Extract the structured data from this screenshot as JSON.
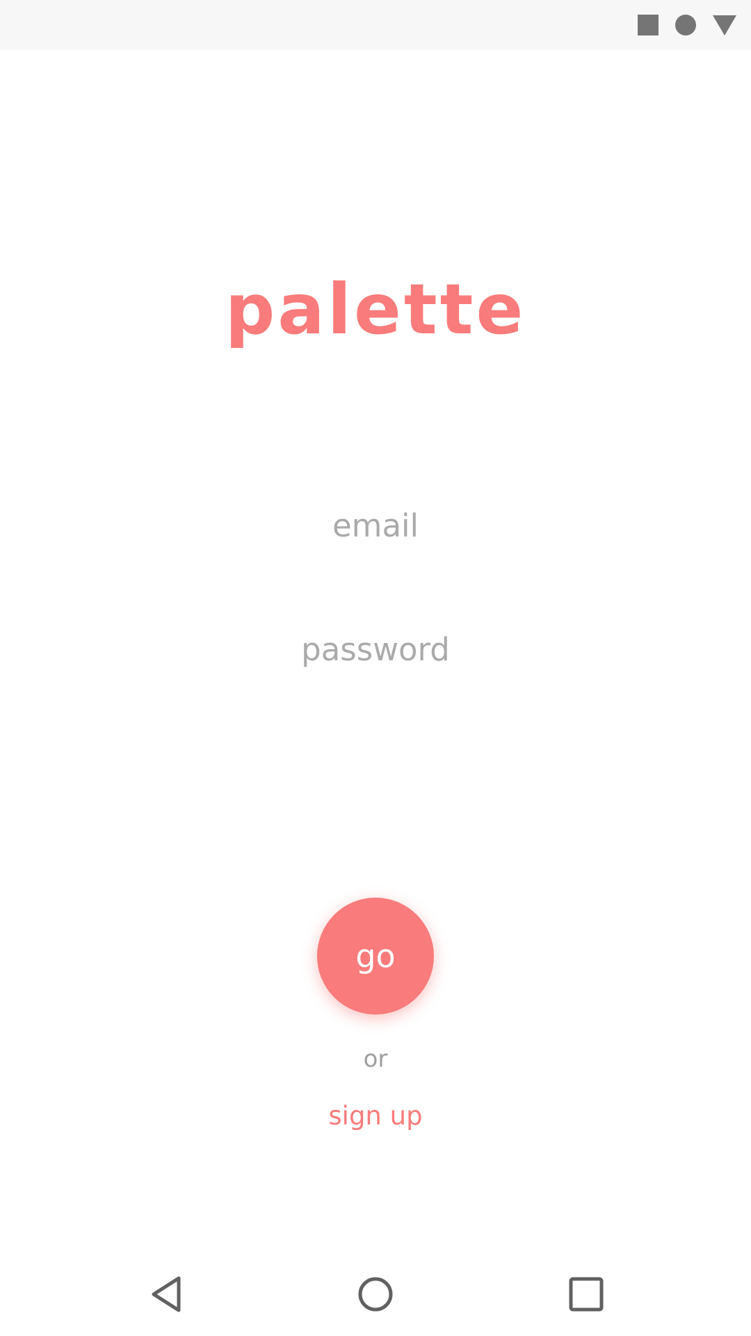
{
  "app": {
    "title": "palette",
    "accent_color": "#f97b7b"
  },
  "status_bar": {
    "icons": [
      "square-icon",
      "circle-icon",
      "triangle-down-icon"
    ]
  },
  "login": {
    "email_placeholder": "email",
    "email_value": "",
    "password_placeholder": "password",
    "password_value": "",
    "go_label": "go",
    "or_label": "or",
    "signup_label": "sign up"
  },
  "nav_bar": {
    "icons": [
      "back-icon",
      "home-icon",
      "recents-icon"
    ]
  }
}
